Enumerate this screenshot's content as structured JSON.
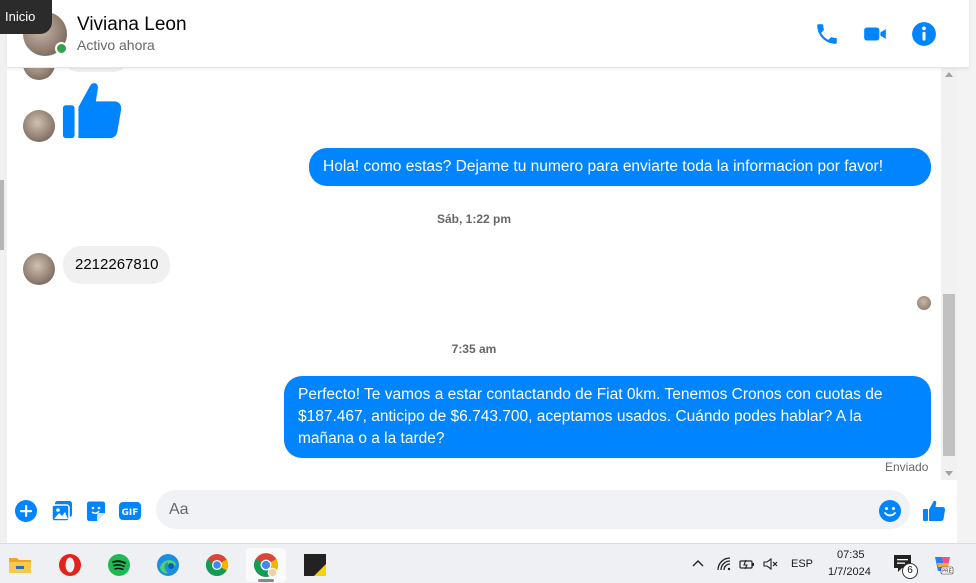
{
  "window": {
    "corner_badge": "Inicio"
  },
  "header": {
    "contact_name": "Viviana Leon",
    "status": "Activo ahora",
    "icons": [
      "phone-icon",
      "video-call-icon",
      "info-icon"
    ],
    "accent_color": "#0084ff",
    "online_color": "#31a24c"
  },
  "messages": {
    "outgoing_1": "Hola! como estas? Dejame tu numero para enviarte toda la informacion por favor!",
    "time_1": "Sáb, 1:22 pm",
    "incoming_1": "2212267810",
    "time_2": "7:35 am",
    "outgoing_2": "Perfecto! Te vamos a estar contactando de Fiat 0km. Tenemos Cronos con cuotas de $187.467, anticipo de $6.743.700, aceptamos usados. Cuándo podes hablar? A la mañana o a la tarde?",
    "sent_status": "Enviado",
    "bubble_out_color": "#0084ff",
    "bubble_in_color": "#f0f0f0"
  },
  "composer": {
    "placeholder": "Aa",
    "icons": [
      "plus-icon",
      "image-icon",
      "sticker-icon",
      "gif-icon",
      "emoji-icon",
      "thumbs-up-icon"
    ]
  },
  "taskbar": {
    "apps": [
      "file-explorer-icon",
      "opera-icon",
      "spotify-icon",
      "edge-icon",
      "chrome-icon",
      "chrome-profile-icon",
      "sticky-app-icon"
    ],
    "language": "ESP",
    "time": "07:35",
    "date": "1/7/2024",
    "notification_count": "6"
  }
}
